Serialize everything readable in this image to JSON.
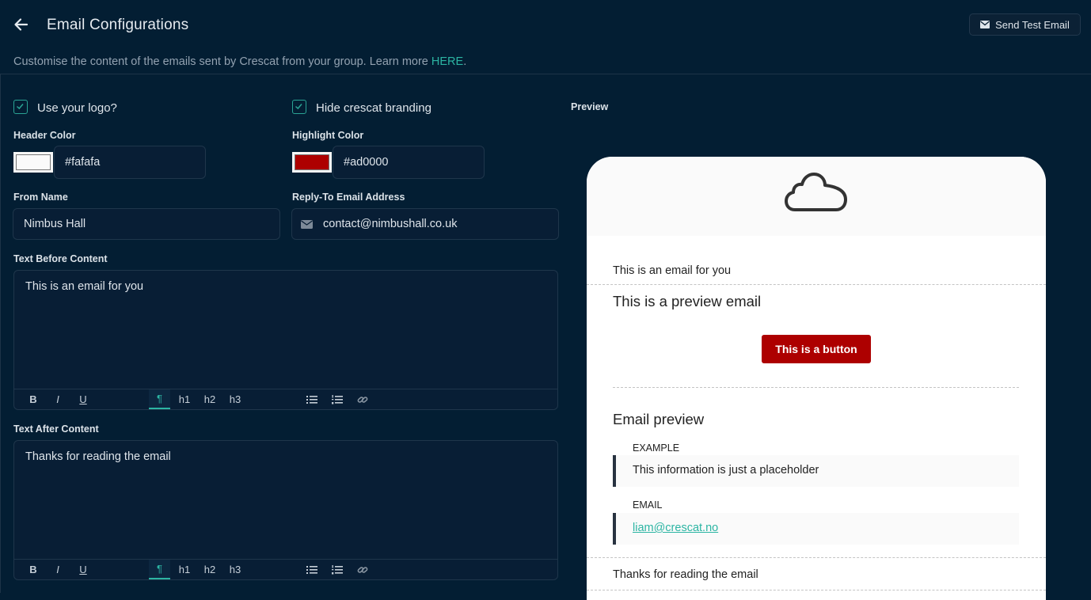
{
  "header": {
    "title": "Email Configurations",
    "send_test_label": "Send Test Email",
    "subtitle_text": "Customise the content of the emails sent by Crescat from your group. Learn more ",
    "subtitle_link": "HERE",
    "subtitle_end": "."
  },
  "form": {
    "use_logo": {
      "label": "Use your logo?",
      "checked": true
    },
    "hide_branding": {
      "label": "Hide crescat branding",
      "checked": true
    },
    "header_color": {
      "label": "Header Color",
      "value": "#fafafa"
    },
    "highlight_color": {
      "label": "Highlight Color",
      "value": "#ad0000"
    },
    "from_name": {
      "label": "From Name",
      "value": "Nimbus Hall"
    },
    "reply_to": {
      "label": "Reply-To Email Address",
      "value": "contact@nimbushall.co.uk"
    },
    "text_before": {
      "label": "Text Before Content",
      "value": "This is an email for you"
    },
    "text_after": {
      "label": "Text After Content",
      "value": "Thanks for reading the email"
    },
    "toolbar": {
      "b": "B",
      "i": "I",
      "u": "U",
      "para": "¶",
      "h1": "h1",
      "h2": "h2",
      "h3": "h3"
    }
  },
  "preview": {
    "label": "Preview",
    "intro": "This is an email for you",
    "heading": "This is a preview email",
    "button": "This is a button",
    "section_title": "Email preview",
    "fields": [
      {
        "label": "EXAMPLE",
        "value": "This information is just a placeholder"
      },
      {
        "label": "EMAIL",
        "value": "liam@crescat.no"
      }
    ],
    "outro": "Thanks for reading the email"
  },
  "colors": {
    "accent": "#2cb5a3",
    "highlight": "#ad0000",
    "header": "#fafafa",
    "background": "#031e33"
  }
}
